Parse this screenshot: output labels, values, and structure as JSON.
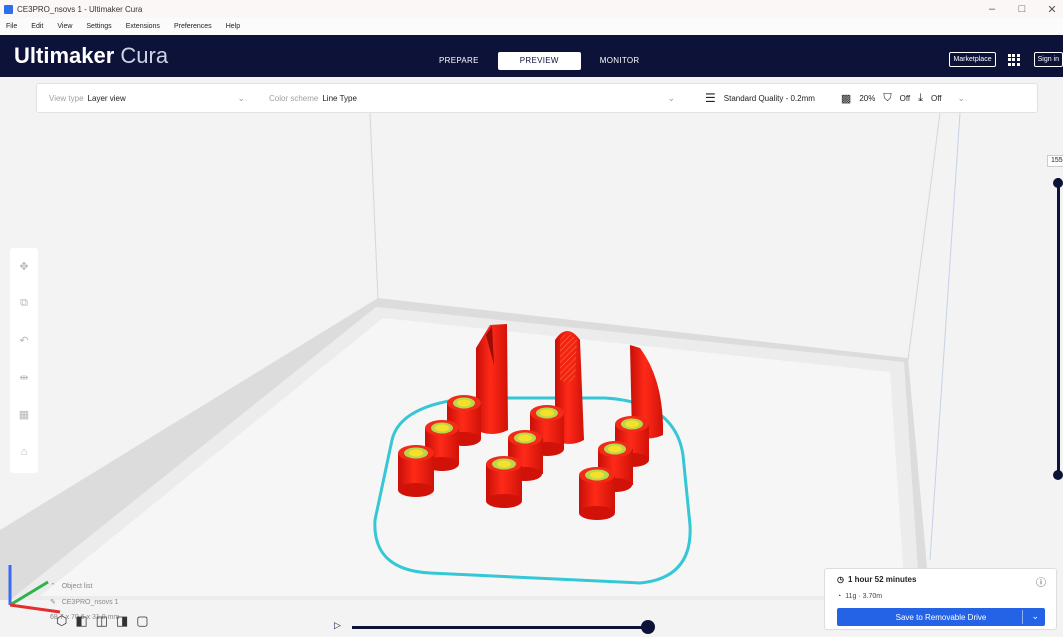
{
  "window": {
    "title": "CE3PRO_nsovs 1 - Ultimaker Cura",
    "controls": [
      "–",
      "□",
      "✕"
    ]
  },
  "menu": [
    "File",
    "Edit",
    "View",
    "Settings",
    "Extensions",
    "Preferences",
    "Help"
  ],
  "header": {
    "logo_bold": "Ultimaker",
    "logo_light": "Cura",
    "tabs": [
      {
        "label": "PREPARE",
        "active": false
      },
      {
        "label": "PREVIEW",
        "active": true
      },
      {
        "label": "MONITOR",
        "active": false
      }
    ],
    "marketplace_label": "Marketplace",
    "signin_label": "Sign in"
  },
  "settings_bar": {
    "view_type_label": "View type",
    "view_type_value": "Layer view",
    "color_scheme_label": "Color scheme",
    "color_scheme_value": "Line Type",
    "quality": "Standard Quality - 0.2mm",
    "infill": "20%",
    "support": "Off",
    "adhesion": "Off"
  },
  "left_tools": [
    "move-tool-icon",
    "scale-tool-icon",
    "rotate-tool-icon",
    "mirror-tool-icon",
    "per-model-settings-icon",
    "support-blocker-icon"
  ],
  "layer_slider": {
    "value": "155"
  },
  "object_list": {
    "title": "Object list",
    "item": "CE3PRO_nsovs 1",
    "dimensions": "68.7 x 70.6 x 31.0 mm"
  },
  "print_panel": {
    "time": "1 hour 52 minutes",
    "material": "11g · 3.70m",
    "save_label": "Save to Removable Drive"
  },
  "colors": {
    "header_bg": "#0d1238",
    "accent": "#2563e6",
    "model_red": "#f01c10",
    "skirt": "#35c7d6"
  }
}
